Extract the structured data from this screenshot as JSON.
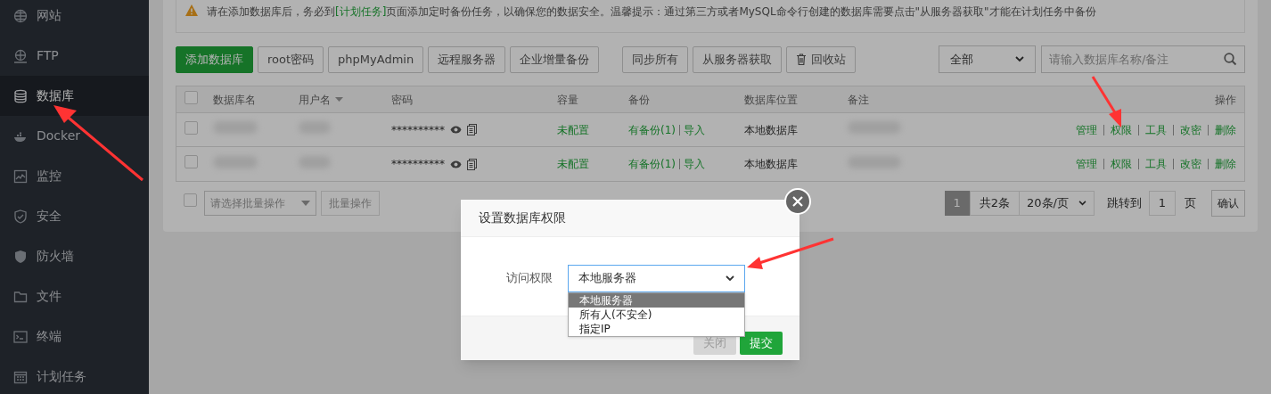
{
  "sidebar": {
    "items": [
      {
        "label": "网站",
        "selected": false
      },
      {
        "label": "FTP",
        "selected": false
      },
      {
        "label": "数据库",
        "selected": true
      },
      {
        "label": "Docker",
        "selected": false
      },
      {
        "label": "监控",
        "selected": false
      },
      {
        "label": "安全",
        "selected": false
      },
      {
        "label": "防火墙",
        "selected": false
      },
      {
        "label": "文件",
        "selected": false
      },
      {
        "label": "终端",
        "selected": false
      },
      {
        "label": "计划任务",
        "selected": false
      }
    ]
  },
  "notice": {
    "before": "请在添加数据库后，务必到",
    "link": "[计划任务]",
    "after": "页面添加定时备份任务，以确保您的数据安全。温馨提示：通过第三方或者MySQL命令行创建的数据库需要点击\"从服务器获取\"才能在计划任务中备份"
  },
  "toolbar": {
    "buttons": [
      {
        "label": "添加数据库",
        "kind": "primary"
      },
      {
        "label": "root密码",
        "kind": "default"
      },
      {
        "label": "phpMyAdmin",
        "kind": "default"
      },
      {
        "label": "远程服务器",
        "kind": "default"
      },
      {
        "label": "企业增量备份",
        "kind": "default"
      },
      {
        "label": "同步所有",
        "kind": "separated"
      },
      {
        "label": "从服务器获取",
        "kind": "default"
      },
      {
        "label": "回收站",
        "kind": "trash"
      }
    ],
    "filter": "全部",
    "search_placeholder": "请输入数据库名称/备注"
  },
  "table": {
    "all_checked": false,
    "columns": [
      "数据库名",
      "用户名",
      "密码",
      "容量",
      "备份",
      "数据库位置",
      "备注",
      "操作"
    ],
    "rows": [
      {
        "checked": false,
        "password": "**********",
        "capacity": "未配置",
        "backup": "有备份(1)",
        "import": "导入",
        "location": "本地数据库",
        "actions": [
          "管理",
          "权限",
          "工具",
          "改密",
          "删除"
        ]
      },
      {
        "checked": false,
        "password": "**********",
        "capacity": "未配置",
        "backup": "有备份(1)",
        "import": "导入",
        "location": "本地数据库",
        "actions": [
          "管理",
          "权限",
          "工具",
          "改密",
          "删除"
        ]
      }
    ]
  },
  "batch": {
    "checked": false,
    "placeholder": "请选择批量操作",
    "button": "批量操作"
  },
  "pagination": {
    "page": "1",
    "total": "共2条",
    "per_page": "20条/页",
    "jump_label": "跳转到",
    "jump_value": "1",
    "page_unit": "页",
    "confirm": "确认"
  },
  "dialog": {
    "title": "设置数据库权限",
    "field_label": "访问权限",
    "value": "本地服务器",
    "options": [
      {
        "label": "本地服务器",
        "selected": true
      },
      {
        "label": "所有人(不安全)",
        "selected": false
      },
      {
        "label": "指定IP",
        "selected": false
      }
    ],
    "buttons": [
      {
        "label": "关闭",
        "kind": "cancel"
      },
      {
        "label": "提交",
        "kind": "submit"
      }
    ]
  }
}
